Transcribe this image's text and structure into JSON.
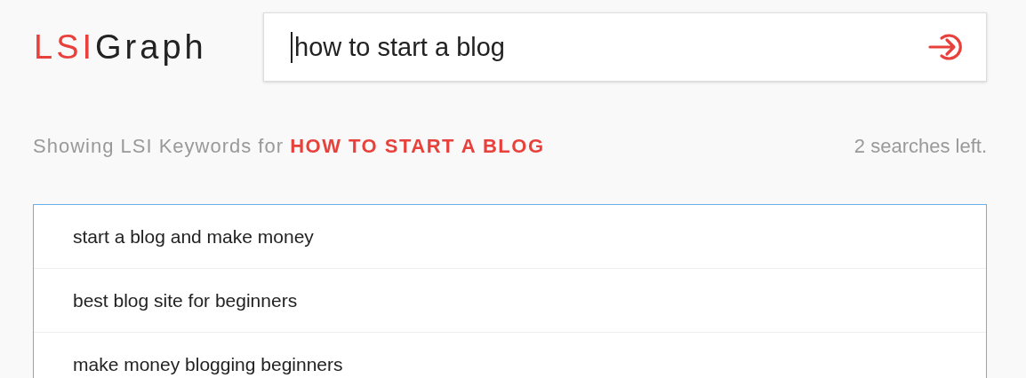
{
  "logo": {
    "accent": "LSI",
    "text": "Graph"
  },
  "search": {
    "value": "how to start a blog"
  },
  "results_heading": {
    "prefix": "Showing LSI Keywords for",
    "query": "HOW TO START A BLOG"
  },
  "searches_left": "2 searches left.",
  "keywords": [
    "start a blog and make money",
    "best blog site for beginners",
    "make money blogging beginners"
  ]
}
